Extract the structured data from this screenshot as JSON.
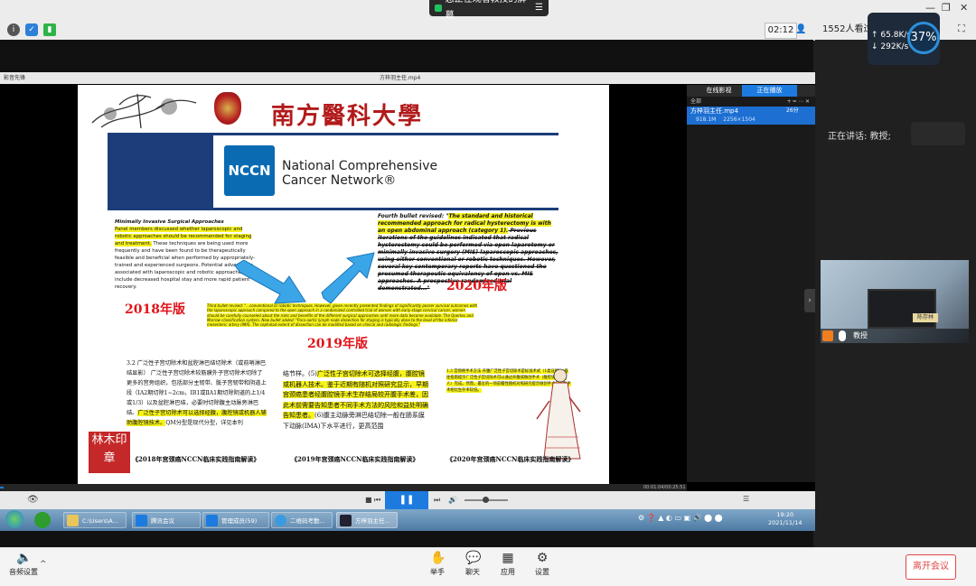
{
  "app": {
    "share_banner": "您正在观看教授的屏幕",
    "clock": "02:12",
    "viewers": "1552人看过",
    "net_up": "65.8K/s",
    "net_down": "292K/s",
    "cpu": "37%"
  },
  "player": {
    "title": "方梓羽主任.mp4",
    "left_label": "影音先锋",
    "tabs": [
      "在线影视",
      "正在播放"
    ],
    "playlist_tool": "全部",
    "item_name": "方梓羽主任.mp4",
    "item_size": "918.1M",
    "item_res": "2256×1504",
    "item_dur": "26分",
    "seek_time": "00:01:04/00:25:51"
  },
  "slide": {
    "univ_name": "南方醫科大學",
    "nccn_abbrev": "NCCN",
    "nccn_line1": "National Comprehensive",
    "nccn_line2": "Cancer Network®",
    "mis_title": "Minimally Invasive Surgical Approaches",
    "mis_hl": "Panel members discussed whether laparoscopic and robotic approaches should be recommended for staging and treatment.",
    "mis_rest": " These techniques are being used more frequently and have been found to be therapeutically feasible and beneficial when performed by appropriately-trained and experienced surgeons. Potential advantages associated with laparoscopic and robotic approaches include decreased hospital stay and more rapid patient recovery.",
    "rev_2020_lead": "Fourth bullet revised: \"",
    "rev_2020_hl": "The standard and historical recommended approach for radical hysterectomy is with an open abdominal approach (category 1).",
    "rev_2020_rest": " Previous iterations of the guidelines indicated that radical hysterectomy could be performed via open laparotomy or minimally invasive surgery (MIS) laparoscopic approaches, using either conventional or robotic techniques. However, several key contemporary reports have questioned the presumed therapeutic equivalency of open vs. MIS approaches. A prospective randomized trial demonstrated...\"",
    "rev_2019_text": "Third bullet revised: \"...conventional or robotic techniques. However, given recently presented findings of significantly poorer survival outcomes with the laparoscopic approach compared to the open approach in a randomized controlled trial of women with early-stage cervical cancer, women should be carefully counseled about the risks and benefits of the different surgical approaches until more data become available. The Querleu and Morrow classification system. New bullet added: \"Para-aortic lymph node dissection for staging is typically done to the level of the inferior mesenteric artery (IMA). The cephalad extent of dissection can be modified based on clinical and radiologic findings.\"",
    "year_2018": "2018年版",
    "year_2019": "2019年版",
    "year_2020": "2020年版",
    "cn_left": "3.2 广泛性子宫切除术和盆腔淋巴结切除术（或前哨淋巴结显影） 广泛性子宫切除术较筋膜外子宫切除术切除了更多的宫旁组织，包括部分主韧带、骶子宫韧带和阴道上段（ⅠA2期切除1~2cm，ⅠB1或ⅡA1期切除阴道的上1/4或1/3）以及盆腔淋巴结，必要时切除腹主动脉旁淋巴结。",
    "cn_left_hl": "广泛性子宫切除术可以选择经腹，腹腔镜或机器人辅助腹腔镜技术。",
    "cn_left_tail": "QM分型是现代分型，详见本刊",
    "cn_mid_a": "结节样。(5)",
    "cn_mid_hl1": "广泛性子宫切除术可选择经腹，腹腔镜或机器人技术。鉴于近期有随机对照研究显示，早期宫颈癌患者经腹腔镜手术生存结局较开腹手术差，因此术前需要告知患者不同手术方法的风险和益处明确告知患者。",
    "cn_mid_b": "(6)腹主动脉旁淋巴结切除一般在肠系膜下动脉(IMA)下水平进行，更高范围",
    "cn_right": "1.3 宫颈癌手术方法 开腹广泛性子宫切除术是标准术式（1类证据）。既往指南提示广泛性子宫切除术可以通过开腹或微创手术（腹腔镜或机器人）完成。然而，最近的一项前瞻性随机对照研究提示微创手术与开腹手术相比生存率较低。",
    "cap1": "《2018年宫颈癌NCCN临床实践指南解读》",
    "cap2": "《2019年宫颈癌NCCN临床实践指南解读》",
    "cap3": "《2020年宫颈癌NCCN临床实践指南解读》",
    "seal_text": "林木印章"
  },
  "taskbar": {
    "items": [
      "C:\\Users\\A...",
      "腾讯会议",
      "管理成员(59)",
      "二维码考勤...",
      "方梓羽主任..."
    ],
    "time": "19:20",
    "date": "2021/11/14"
  },
  "side": {
    "speaking": "正在讲话: 教授;",
    "cam_label": "教授",
    "cam_tag": "陈存林"
  },
  "toolbar": {
    "audio": "音频设置",
    "raise_hand": "举手",
    "chat": "聊天",
    "apps": "应用",
    "settings": "设置",
    "leave": "离开会议"
  },
  "colors": {
    "accent": "#1d7be0",
    "year_red": "#e0141a",
    "nccn_blue": "#1c3d7a",
    "highlight": "#f7f31c"
  }
}
